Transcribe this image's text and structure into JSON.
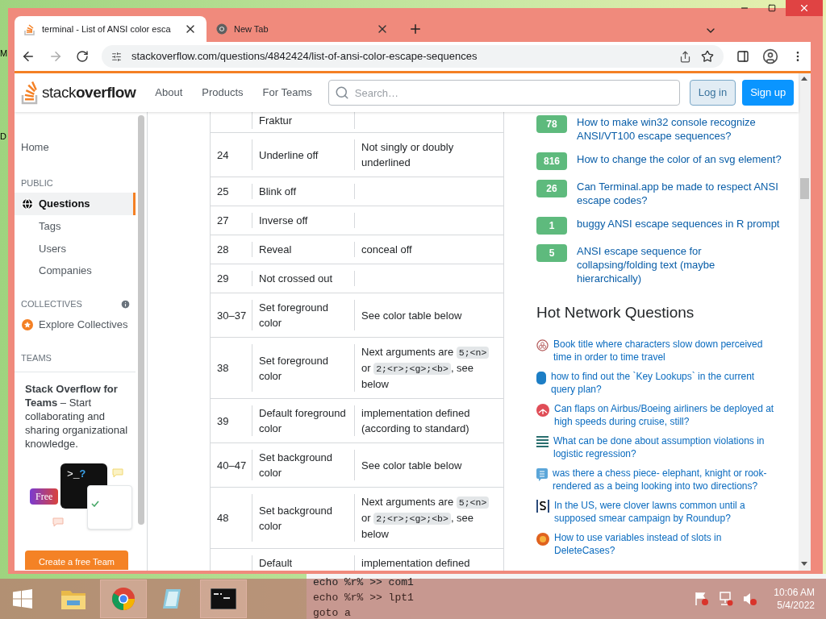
{
  "desktop": {
    "icon_labels": [
      "M",
      "D"
    ]
  },
  "browser": {
    "tabs": [
      {
        "title": "terminal - List of ANSI color esca",
        "selected": true
      },
      {
        "title": "New Tab",
        "selected": false
      }
    ],
    "url": "stackoverflow.com/questions/4842424/list-of-ansi-color-escape-sequences"
  },
  "site_header": {
    "logo": "stack**overflow**",
    "nav": [
      "About",
      "Products",
      "For Teams"
    ],
    "search": {
      "placeholder": "Search…"
    },
    "buttons": [
      {
        "label": "Log in",
        "kind": "secondary"
      },
      {
        "label": "Sign up",
        "kind": "primary"
      }
    ]
  },
  "sidebar": {
    "items": [
      {
        "kind": "link",
        "label": "Home",
        "selected": false
      },
      {
        "kind": "heading",
        "label": "PUBLIC"
      },
      {
        "kind": "globe-link",
        "label": "Questions",
        "selected": true
      },
      {
        "kind": "sublink",
        "label": "Tags",
        "selected": false
      },
      {
        "kind": "sublink",
        "label": "Users",
        "selected": false
      },
      {
        "kind": "sublink",
        "label": "Companies",
        "selected": false
      },
      {
        "kind": "heading-info",
        "label": "COLLECTIVES"
      },
      {
        "kind": "collective-link",
        "label": "Explore Collectives",
        "selected": false
      },
      {
        "kind": "heading",
        "label": "TEAMS"
      }
    ],
    "teams_promo": {
      "text": "**Stack Overflow for Teams** – Start collaborating and sharing organizational knowledge.",
      "prompt": ">_",
      "prompt_mark": "?",
      "badge": "Free",
      "button": "Create a free Team"
    }
  },
  "table": {
    "rows": [
      {
        "name": "Fraktur"
      },
      {
        "code": "24",
        "name": "Underline off",
        "note": [
          {
            "kind": "text",
            "text": "Not singly or doubly underlined"
          }
        ]
      },
      {
        "code": "25",
        "name": "Blink off"
      },
      {
        "code": "27",
        "name": "Inverse off"
      },
      {
        "code": "28",
        "name": "Reveal",
        "note": [
          {
            "kind": "text",
            "text": "conceal off"
          }
        ]
      },
      {
        "code": "29",
        "name": "Not crossed out"
      },
      {
        "code": "30–37",
        "name": "Set foreground color",
        "note": [
          {
            "kind": "text",
            "text": "See color table below"
          }
        ]
      },
      {
        "code": "38",
        "name": "Set foreground color",
        "note": [
          {
            "kind": "text",
            "text": "Next arguments are "
          },
          {
            "kind": "code",
            "text": "5;<n>"
          },
          {
            "kind": "text",
            "text": " or "
          },
          {
            "kind": "code",
            "text": "2;<r>;<g>;<b>"
          },
          {
            "kind": "text",
            "text": ", see below"
          }
        ]
      },
      {
        "code": "39",
        "name": "Default foreground color",
        "note": [
          {
            "kind": "text",
            "text": "implementation defined (according to standard)"
          }
        ]
      },
      {
        "code": "40–47",
        "name": "Set background color",
        "note": [
          {
            "kind": "text",
            "text": "See color table below"
          }
        ]
      },
      {
        "code": "48",
        "name": "Set background color",
        "note": [
          {
            "kind": "text",
            "text": "Next arguments are "
          },
          {
            "kind": "code",
            "text": "5;<n>"
          },
          {
            "kind": "text",
            "text": " or "
          },
          {
            "kind": "code",
            "text": "2;<r>;<g>;<b>"
          },
          {
            "kind": "text",
            "text": ", see below"
          }
        ]
      },
      {
        "name": "Default",
        "note": [
          {
            "kind": "text",
            "text": "implementation defined"
          }
        ]
      }
    ]
  },
  "linked": [
    {
      "score": "78",
      "title": "How to make win32 console recognize ANSI/VT100 escape sequences?"
    },
    {
      "score": "816",
      "title": "How to change the color of an svg element?"
    },
    {
      "score": "26",
      "title": "Can Terminal.app be made to respect ANSI escape codes?"
    },
    {
      "score": "1",
      "title": "buggy ANSI escape sequences in R prompt"
    },
    {
      "score": "5",
      "title": "ANSI escape sequence for collapsing/folding text (maybe hierarchically)"
    }
  ],
  "hot_network": {
    "title": "Hot Network Questions",
    "items": [
      {
        "kind": "scifi",
        "title": "Book title where characters slow down perceived time in order to time travel"
      },
      {
        "kind": "dba",
        "title": "how to find out the `Key Lookups` in the current query plan?"
      },
      {
        "kind": "aviation",
        "title": "Can flaps on Airbus/Boeing airliners be deployed at high speeds during cruise, still?"
      },
      {
        "kind": "stats",
        "title": "What can be done about assumption violations in logistic regression?"
      },
      {
        "kind": "chess",
        "title": "was there a chess piece- elephant, knight or rook- rendered as a being looking into two directions?"
      },
      {
        "kind": "skeptics",
        "title": "In the US, were clover lawns common until a supposed smear campaign by Roundup?"
      },
      {
        "kind": "mathematica",
        "title": "How to use variables instead of slots in DeleteCases?"
      }
    ]
  },
  "terminal": {
    "lines": [
      "echo %r% >> com1",
      "echo %r% >> lpt1",
      "goto a"
    ]
  },
  "taskbar": {
    "apps": [
      {
        "kind": "explorer",
        "running": false
      },
      {
        "kind": "chrome",
        "running": true
      },
      {
        "kind": "notepad",
        "running": false
      },
      {
        "kind": "cmd",
        "running": true
      }
    ],
    "clock": {
      "time": "10:06 AM",
      "date": "5/4/2022"
    }
  }
}
